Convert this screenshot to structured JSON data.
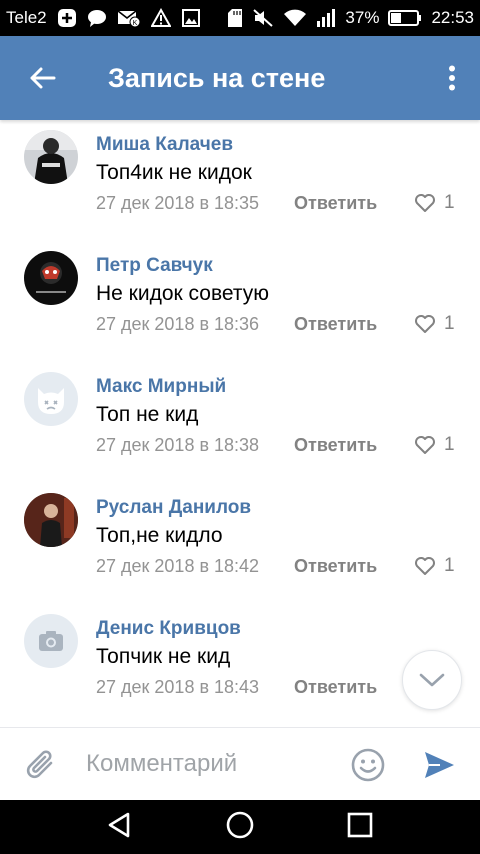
{
  "status_bar": {
    "carrier": "Tele2",
    "battery_percent": "37%",
    "time": "22:53",
    "icons": [
      "plus-badge-icon",
      "chat-icon",
      "vk-mail-icon",
      "warning-icon",
      "image-icon",
      "sd-card-icon",
      "mute-icon",
      "wifi-icon",
      "signal-icon",
      "battery-icon"
    ]
  },
  "toolbar": {
    "title": "Запись на стене",
    "back_icon": "arrow-left-icon",
    "menu_icon": "more-vertical-icon",
    "background": "#5181b8"
  },
  "comments": [
    {
      "author": "Миша Калачев",
      "text": "Топ4ик не кидок",
      "date": "27 дек 2018 в 18:35",
      "reply_label": "Ответить",
      "likes": "1"
    },
    {
      "author": "Петр Савчук",
      "text": "Не кидок советую",
      "date": "27 дек 2018 в 18:36",
      "reply_label": "Ответить",
      "likes": "1"
    },
    {
      "author": "Макс Мирный",
      "text": "Топ не кид",
      "date": "27 дек 2018 в 18:38",
      "reply_label": "Ответить",
      "likes": "1"
    },
    {
      "author": "Руслан Данилов",
      "text": "Топ,не кидло",
      "date": "27 дек 2018 в 18:42",
      "reply_label": "Ответить",
      "likes": "1"
    },
    {
      "author": "Денис Кривцов",
      "text": "Топчик не кид",
      "date": "27 дек 2018 в 18:43",
      "reply_label": "Ответить",
      "likes": ""
    }
  ],
  "composer": {
    "placeholder": "Комментарий"
  },
  "colors": {
    "accent": "#5181b8",
    "link": "#4a76a8",
    "meta": "#939393"
  }
}
